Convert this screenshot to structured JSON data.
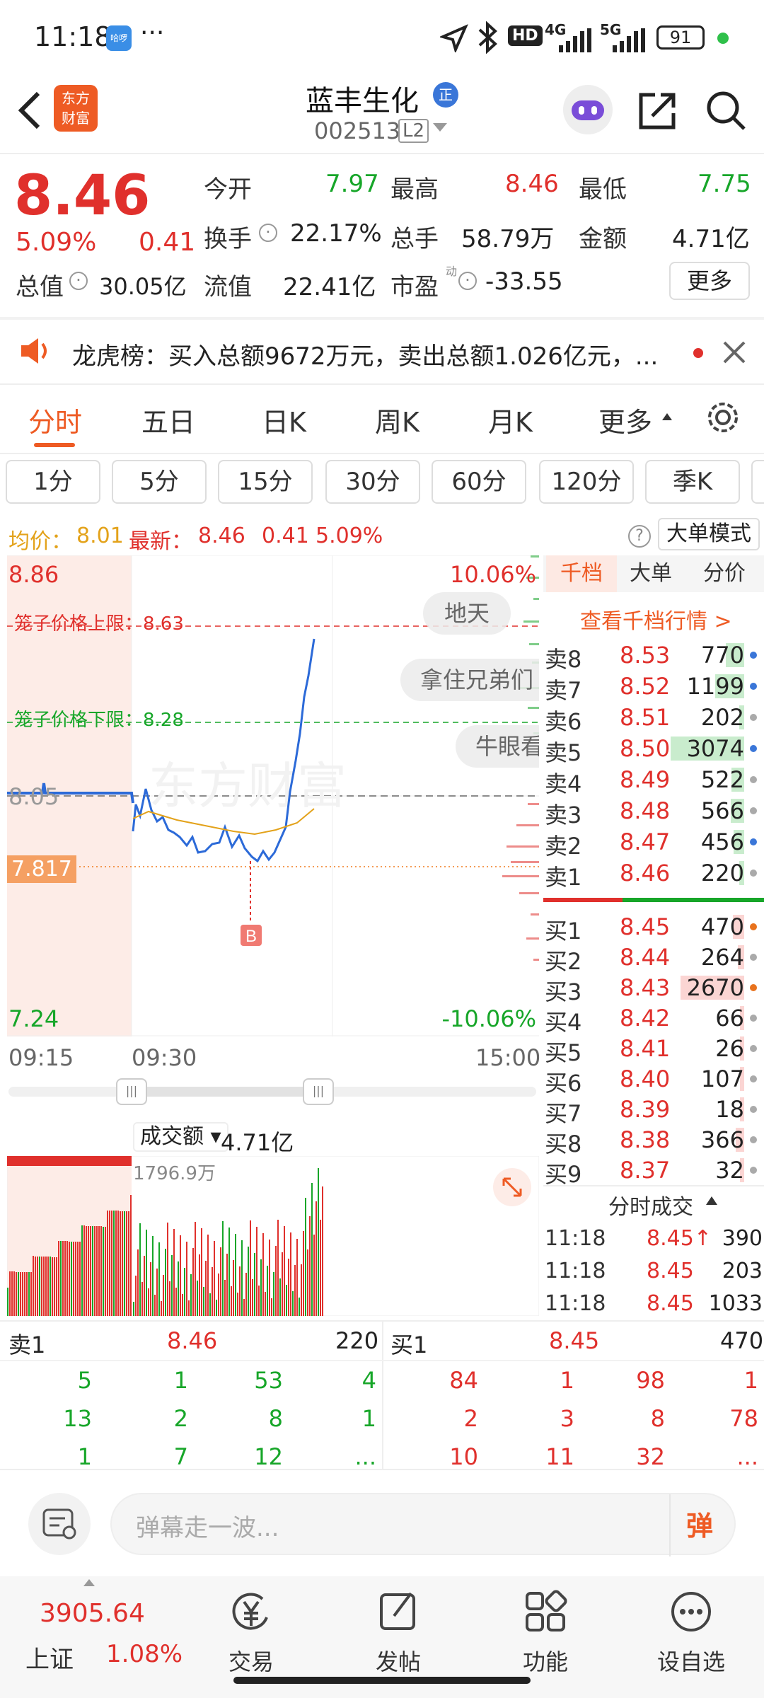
{
  "status": {
    "time": "11:18",
    "app_badge": "哈啰",
    "dots": "···",
    "network": "4G",
    "network2": "5G",
    "battery": "91"
  },
  "header": {
    "logo_line1": "东方",
    "logo_line2": "财富",
    "stock_name": "蓝丰生化",
    "code": "002513",
    "level": "L2",
    "badge": "正"
  },
  "quote": {
    "price": "8.46",
    "pct": "5.09%",
    "change": "0.41",
    "open_label": "今开",
    "open": "7.97",
    "high_label": "最高",
    "high": "8.46",
    "low_label": "最低",
    "low": "7.75",
    "turnover_label": "换手",
    "turnover": "22.17%",
    "volume_label": "总手",
    "volume": "58.79万",
    "amount_label": "金额",
    "amount": "4.71亿",
    "mktcap_label": "总值",
    "mktcap": "30.05亿",
    "float_label": "流值",
    "float": "22.41亿",
    "pe_label": "市盈",
    "pe_sup": "动",
    "pe": "-33.55",
    "more": "更多"
  },
  "notice": {
    "text": "龙虎榜：买入总额9672万元，卖出总额1.026亿元，..."
  },
  "tabs": [
    "分时",
    "五日",
    "日K",
    "周K",
    "月K",
    "更多"
  ],
  "subtabs": [
    "1分",
    "5分",
    "15分",
    "30分",
    "60分",
    "120分",
    "季K"
  ],
  "info": {
    "avg_label": "均价：",
    "avg": "8.01",
    "latest_label": "最新：",
    "latest": "8.46",
    "chg": "0.41",
    "pct": "5.09%",
    "mode": "大单模式"
  },
  "chart": {
    "top_price": "8.86",
    "bottom_price": "7.24",
    "top_pct": "10.06%",
    "bottom_pct": "-10.06%",
    "upper_label": "笼子价格上限：8.63",
    "lower_label": "笼子价格下限：8.28",
    "ref_price": "8.05",
    "cross_price": "7.817",
    "marker": "B",
    "t_start": "09:15",
    "t_open": "09:30",
    "t_end": "15:00",
    "bubbles": [
      "地天",
      "拿住兄弟们",
      "牛眼看"
    ],
    "watermark": "东方财富"
  },
  "volume": {
    "label": "成交额",
    "value": "4.71亿",
    "max": "1796.9万"
  },
  "orderbook": {
    "tabs": [
      "千档",
      "大单",
      "分价"
    ],
    "link": "查看千档行情 >",
    "asks": [
      {
        "l": "卖8",
        "p": "8.53",
        "v": "770",
        "dot": "#3a76d8"
      },
      {
        "l": "卖7",
        "p": "8.52",
        "v": "1199",
        "dot": "#3a76d8"
      },
      {
        "l": "卖6",
        "p": "8.51",
        "v": "202",
        "dot": "#aaa"
      },
      {
        "l": "卖5",
        "p": "8.50",
        "v": "3074",
        "dot": "#3a76d8"
      },
      {
        "l": "卖4",
        "p": "8.49",
        "v": "522",
        "dot": "#aaa"
      },
      {
        "l": "卖3",
        "p": "8.48",
        "v": "566",
        "dot": "#aaa"
      },
      {
        "l": "卖2",
        "p": "8.47",
        "v": "456",
        "dot": "#3a76d8"
      },
      {
        "l": "卖1",
        "p": "8.46",
        "v": "220",
        "dot": "#aaa"
      }
    ],
    "bids": [
      {
        "l": "买1",
        "p": "8.45",
        "v": "470",
        "dot": "#e8721d"
      },
      {
        "l": "买2",
        "p": "8.44",
        "v": "264",
        "dot": "#aaa"
      },
      {
        "l": "买3",
        "p": "8.43",
        "v": "2670",
        "dot": "#e8721d"
      },
      {
        "l": "买4",
        "p": "8.42",
        "v": "66",
        "dot": "#aaa"
      },
      {
        "l": "买5",
        "p": "8.41",
        "v": "26",
        "dot": "#aaa"
      },
      {
        "l": "买6",
        "p": "8.40",
        "v": "107",
        "dot": "#aaa"
      },
      {
        "l": "买7",
        "p": "8.39",
        "v": "18",
        "dot": "#aaa"
      },
      {
        "l": "买8",
        "p": "8.38",
        "v": "366",
        "dot": "#aaa"
      },
      {
        "l": "买9",
        "p": "8.37",
        "v": "32",
        "dot": "#aaa"
      }
    ],
    "trades_title": "分时成交",
    "trades": [
      {
        "t": "11:18",
        "p": "8.45↑",
        "v": "390"
      },
      {
        "t": "11:18",
        "p": "8.45",
        "v": "203"
      },
      {
        "t": "11:18",
        "p": "8.45",
        "v": "1033"
      }
    ]
  },
  "detail": {
    "sell_label": "卖1",
    "sell_price": "8.46",
    "sell_vol": "220",
    "buy_label": "买1",
    "buy_price": "8.45",
    "buy_vol": "470",
    "sell_rows": [
      [
        "5",
        "1",
        "53",
        "4"
      ],
      [
        "13",
        "2",
        "8",
        "1"
      ],
      [
        "1",
        "7",
        "12",
        "..."
      ]
    ],
    "buy_rows": [
      [
        "84",
        "1",
        "98",
        "1"
      ],
      [
        "2",
        "3",
        "8",
        "78"
      ],
      [
        "10",
        "11",
        "32",
        "..."
      ]
    ]
  },
  "danmu": {
    "placeholder": "弹幕走一波...",
    "send": "弹"
  },
  "nav": {
    "index_value": "3905.64",
    "index_name": "上证",
    "index_pct": "1.08%",
    "items": [
      "交易",
      "发帖",
      "功能",
      "设自选"
    ]
  }
}
